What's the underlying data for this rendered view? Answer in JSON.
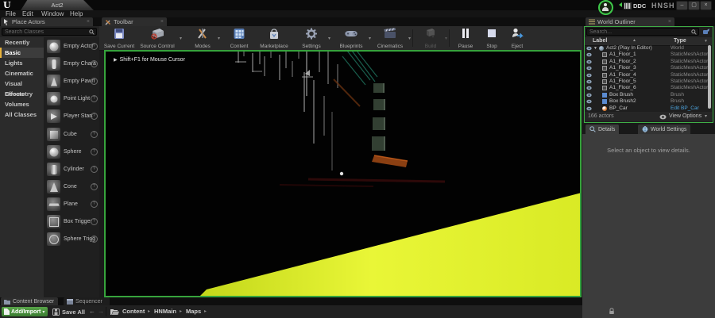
{
  "glyphs": {
    "close": "×",
    "caret": "▾",
    "sort": "▲",
    "sep": "▸",
    "back": "←",
    "forward": "→",
    "play": "▶",
    "expanded": "▼",
    "minimize": "–",
    "restore": "▢",
    "filter": "▼",
    "info": "?"
  },
  "colors": {
    "pie_border": "#36a33c",
    "wedge_yellow": "#e4f12c",
    "add_import_green": "#4f9a3f",
    "link_blue": "#4da6e0",
    "category_accent": "#e8b23a",
    "avatar_ring": "#3ec94a"
  },
  "window": {
    "logo": "U",
    "level_tab": "Act2",
    "ddc": "DDC",
    "project": "HNSH",
    "menu": [
      "File",
      "Edit",
      "Window",
      "Help"
    ]
  },
  "place_actors": {
    "tab": "Place Actors",
    "search": "Search Classes",
    "categories": [
      "Recently Placed",
      "Basic",
      "Lights",
      "Cinematic",
      "Visual Effects",
      "Geometry",
      "Volumes",
      "All Classes"
    ],
    "selected_category": "Basic",
    "items": [
      "Empty Actor",
      "Empty Chara",
      "Empty Pawn",
      "Point Light",
      "Player Start",
      "Cube",
      "Sphere",
      "Cylinder",
      "Cone",
      "Plane",
      "Box Trigger",
      "Sphere Trigg"
    ]
  },
  "toolbar": {
    "tab": "Toolbar",
    "buttons": [
      "Save Current",
      "Source Control",
      "Modes",
      "Content",
      "Marketplace",
      "Settings",
      "Blueprints",
      "Cinematics",
      "Build",
      "Pause",
      "Stop",
      "Eject"
    ]
  },
  "viewport": {
    "hint": "Shift+F1 for Mouse Cursor"
  },
  "world_outliner": {
    "tab": "World Outliner",
    "search": "Search...",
    "col_label": "Label",
    "col_type": "Type",
    "rows": [
      {
        "label": "Act2 (Play In Editor)",
        "type": "World"
      },
      {
        "label": "A1_Floor_1",
        "type": "StaticMeshActor"
      },
      {
        "label": "A1_Floor_2",
        "type": "StaticMeshActor"
      },
      {
        "label": "A1_Floor_3",
        "type": "StaticMeshActor"
      },
      {
        "label": "A1_Floor_4",
        "type": "StaticMeshActor"
      },
      {
        "label": "A1_Floor_5",
        "type": "StaticMeshActor"
      },
      {
        "label": "A1_Floor_6",
        "type": "StaticMeshActor"
      },
      {
        "label": "Box Brush",
        "type": "Brush"
      },
      {
        "label": "Box Brush2",
        "type": "Brush"
      },
      {
        "label": "BP_Car",
        "type": "Edit BP_Car"
      }
    ],
    "footer_count": "166 actors",
    "view_options": "View Options"
  },
  "details": {
    "tab_details": "Details",
    "tab_world_settings": "World Settings",
    "empty": "Select an object to view details."
  },
  "bottom": {
    "tab_content_browser": "Content Browser",
    "tab_sequencer": "Sequencer",
    "add_import": "Add/Import",
    "save_all": "Save All",
    "crumbs": [
      "Content",
      "HNMain",
      "Maps"
    ]
  }
}
